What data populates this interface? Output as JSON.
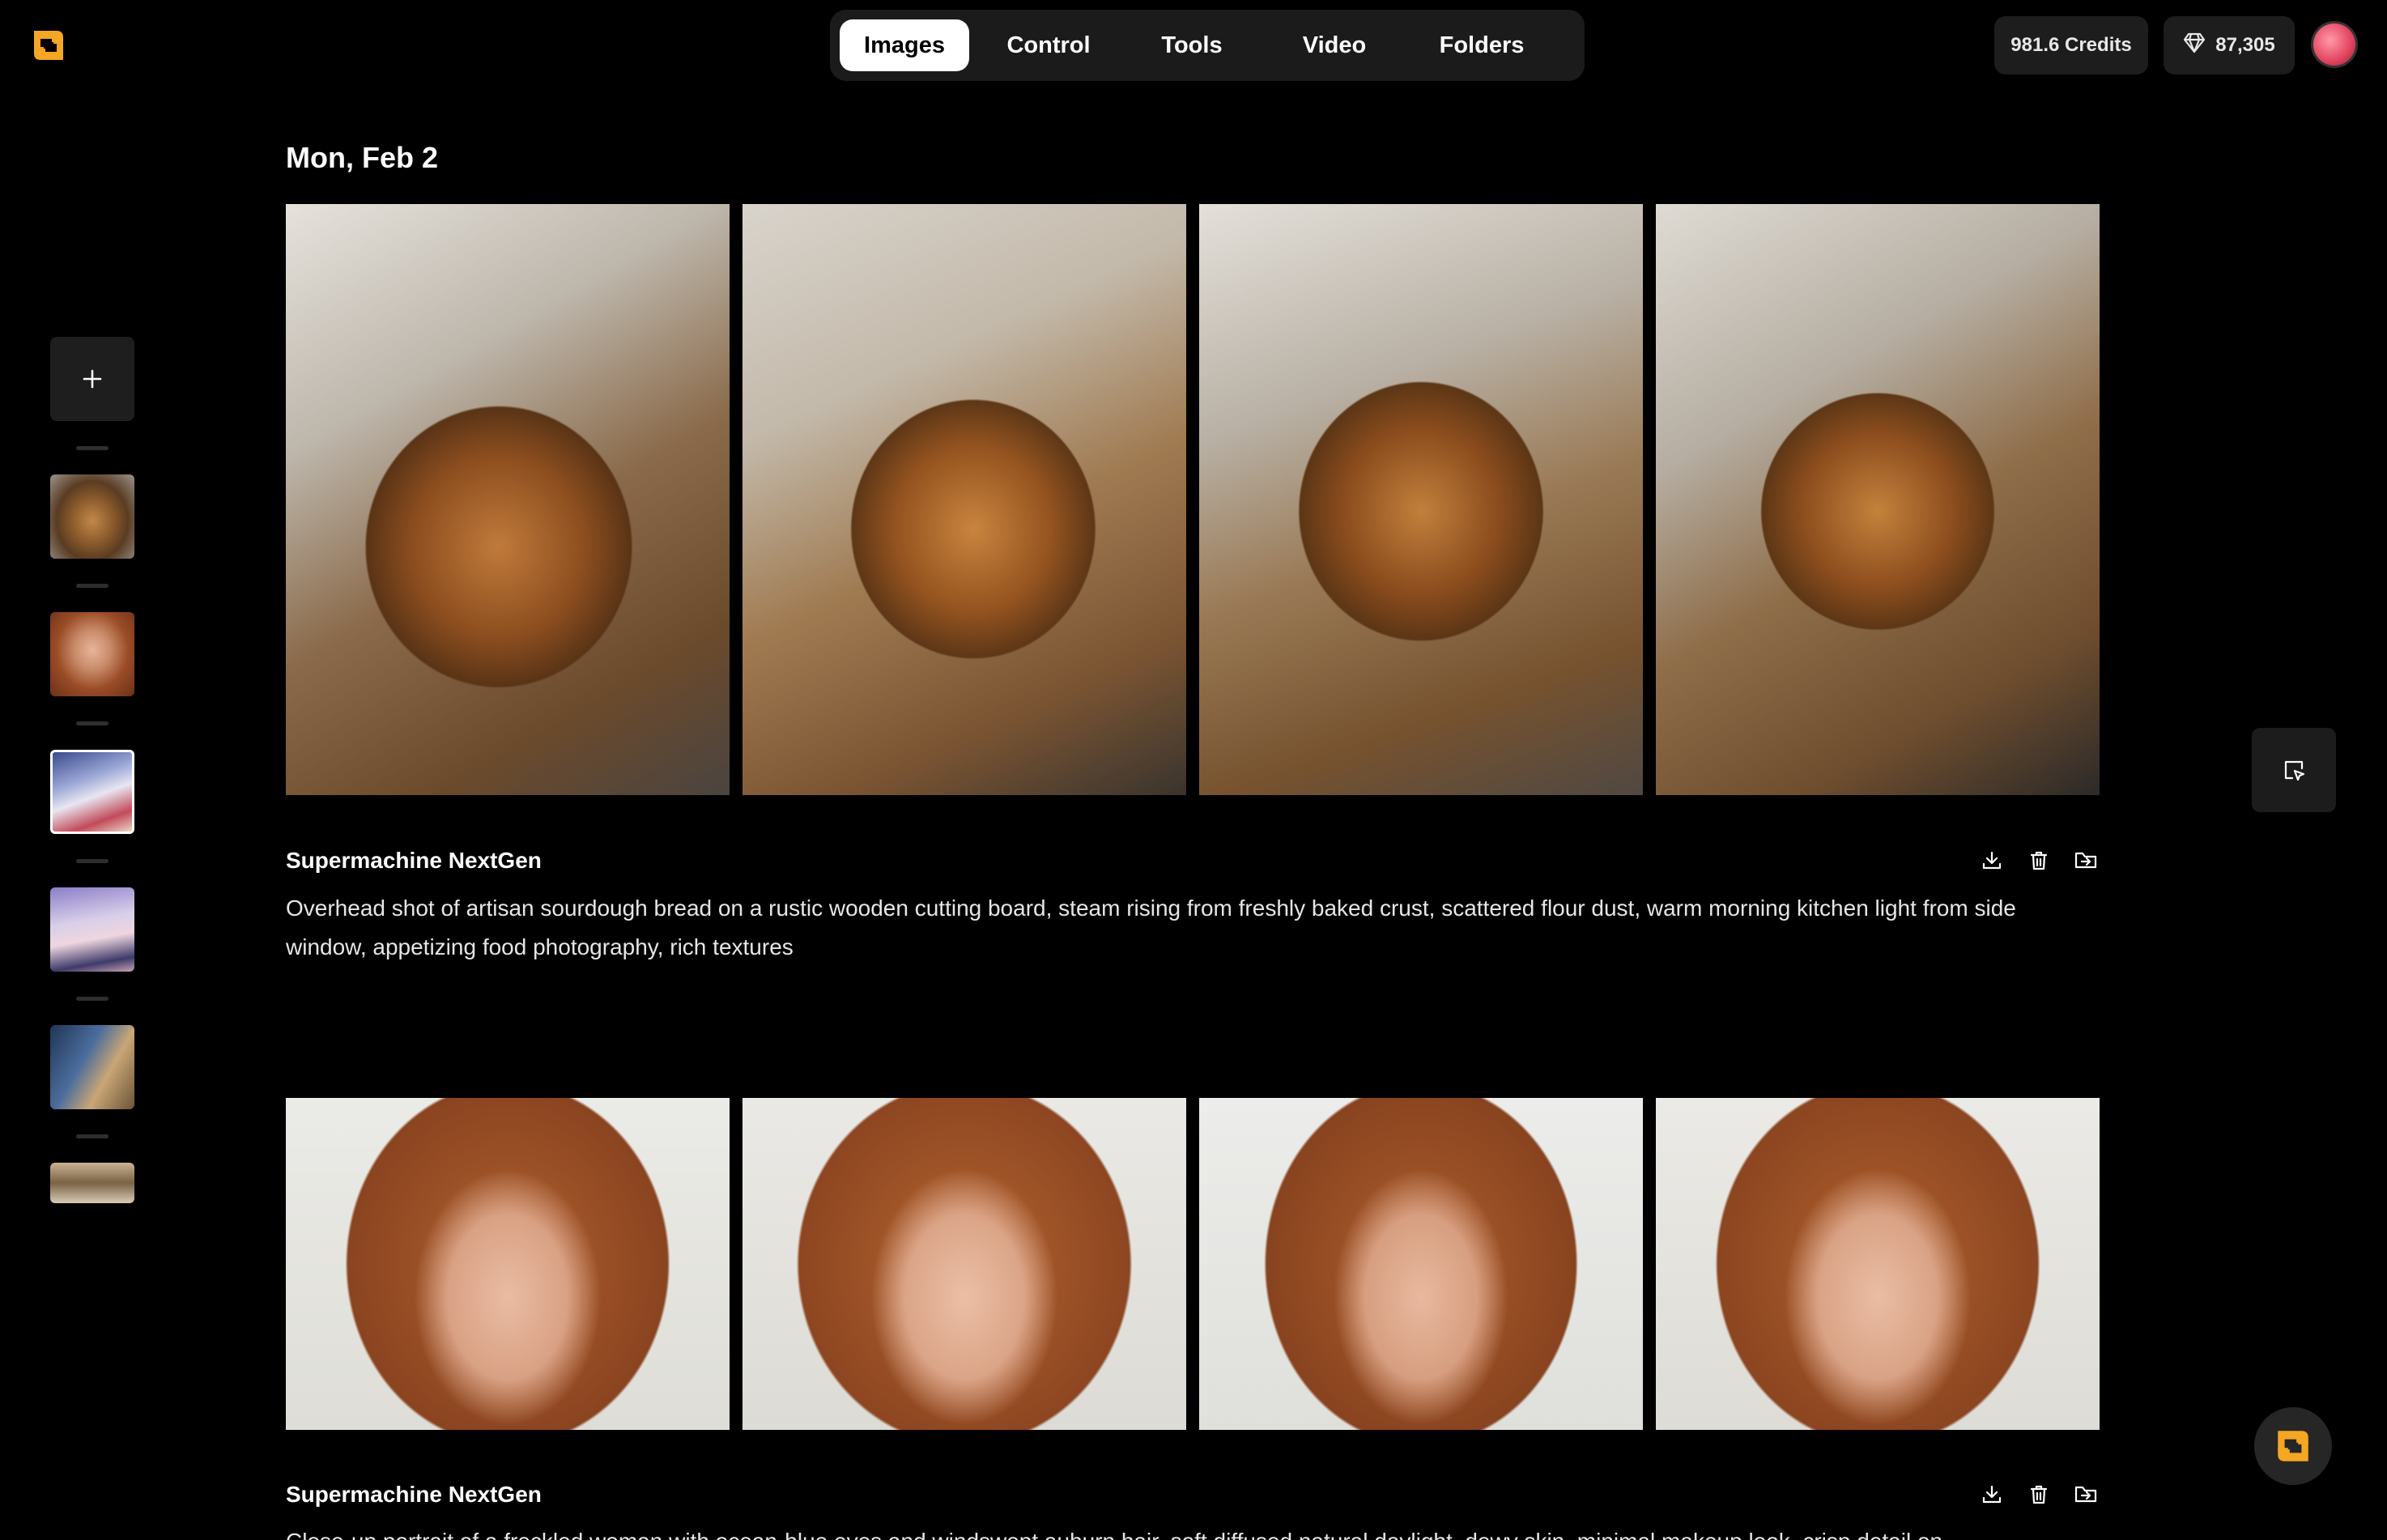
{
  "nav": {
    "tabs": [
      "Images",
      "Control",
      "Tools",
      "Video",
      "Folders"
    ],
    "active": "Images"
  },
  "header": {
    "credits": "981.6 Credits",
    "gems": "87,305"
  },
  "feed": {
    "date": "Mon, Feb 2",
    "groups": [
      {
        "model": "Supermachine NextGen",
        "prompt": "Overhead shot of artisan sourdough bread on a rustic wooden cutting board, steam rising from freshly baked crust, scattered flour dust, warm morning kitchen light from side window, appetizing food photography, rich textures"
      },
      {
        "model": "Supermachine NextGen",
        "prompt": "Close-up portrait of a freckled woman with ocean-blue eyes and windswept auburn hair, soft diffused natural daylight, dewy skin, minimal makeup look, crisp detail on"
      }
    ]
  },
  "colors": {
    "brand_orange": "#f5a623",
    "background": "#000000",
    "panel": "#1b1b1b"
  }
}
